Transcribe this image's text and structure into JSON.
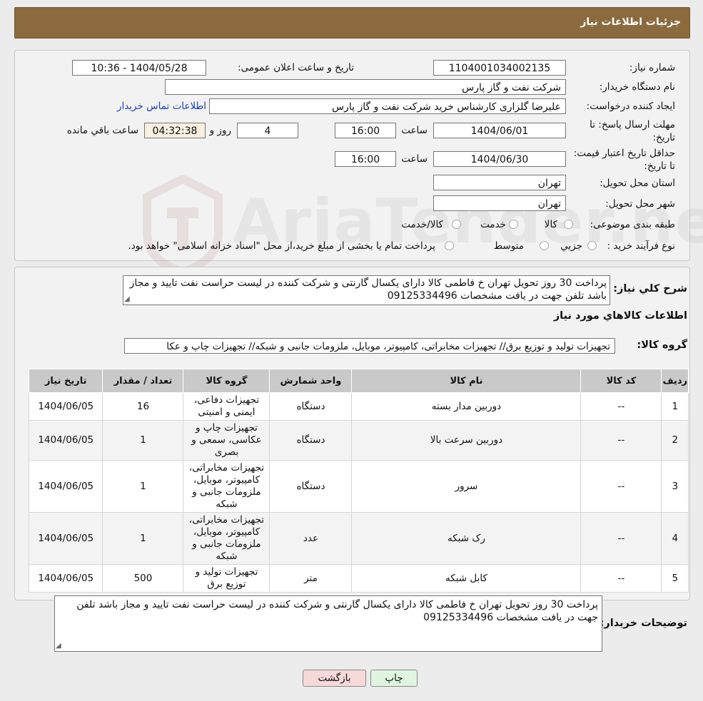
{
  "header": {
    "title": "جزئیات اطلاعات نیاز"
  },
  "form": {
    "need_number_label": "شماره نیاز:",
    "need_number": "1104001034002135",
    "announce_label": "تاریخ و ساعت اعلان عمومی:",
    "announce_value": "1404/05/28 - 10:36",
    "buyer_org_label": "نام دستگاه خریدار:",
    "buyer_org": "شرکت نفت و گاز پارس",
    "creator_label": "ایجاد کننده درخواست:",
    "creator": "علیرضا  گلزاری کارشناس خرید  شرکت نفت و گاز پارس",
    "contact_link": "اطلاعات تماس خریدار",
    "deadline_label": "مهلت ارسال پاسخ: تا تاریخ:",
    "deadline_date": "1404/06/01",
    "time_label": "ساعت",
    "deadline_time": "16:00",
    "days_value": "4",
    "days_label": "روز و",
    "remaining_time": "04:32:38",
    "remaining_label": "ساعت باقي مانده",
    "validity_label": "حداقل تاریخ اعتبار قیمت: تا تاریخ:",
    "validity_date": "1404/06/30",
    "validity_time": "16:00",
    "province_label": "استان محل تحویل:",
    "province": "تهران",
    "city_label": "شهر محل تحویل:",
    "city": "تهران",
    "category_label": "طبقه بندی موضوعی:",
    "category_options": [
      "کالا",
      "خدمت",
      "کالا/خدمت"
    ],
    "process_label": "نوع فرآیند خرید :",
    "process_options": [
      "جزیي",
      "متوسط"
    ],
    "process_note": "پرداخت تمام یا بخشی از مبلغ خرید،از محل \"اسناد خزانه اسلامی\" خواهد بود."
  },
  "summary": {
    "label": "شرح کلي نياز:",
    "text": "پرداخت 30 روز تحویل تهران خ فاطمی کالا دارای یکسال گارنتی  و شرکت کننده در لیست حراست نفت تایید و مجاز باشد تلفن جهت در یافت مشخصات 09125334496",
    "items_title": "اطلاعات کالاهاي مورد نياز",
    "group_label": "گروه کالا:",
    "group_value": "تجهیزات تولید و توزیع برق// تجهیزات مخابراتی، کامپیوتر، موبایل، ملزومات جانبی و شبکه// تجهیزات چاپ و عکا"
  },
  "table": {
    "headers": [
      "ردیف",
      "کد کالا",
      "نام کالا",
      "واحد شمارش",
      "گروه کالا",
      "تعداد / مقدار",
      "تاریخ نیاز"
    ],
    "rows": [
      {
        "row": "1",
        "code": "--",
        "name": "دوربین مدار بسته",
        "unit": "دستگاه",
        "group": "تجهیزات دفاعی، ایمنی و امنیتی",
        "qty": "16",
        "date": "1404/06/05"
      },
      {
        "row": "2",
        "code": "--",
        "name": "دوربین سرعت بالا",
        "unit": "دستگاه",
        "group": "تجهیزات چاپ و عکاسی، سمعی و بصری",
        "qty": "1",
        "date": "1404/06/05"
      },
      {
        "row": "3",
        "code": "--",
        "name": "سرور",
        "unit": "دستگاه",
        "group": "تجهیزات مخابراتی، کامپیوتر، موبایل، ملزومات جانبی و شبکه",
        "qty": "1",
        "date": "1404/06/05"
      },
      {
        "row": "4",
        "code": "--",
        "name": "رک شبکه",
        "unit": "عدد",
        "group": "تجهیزات مخابراتی، کامپیوتر، موبایل، ملزومات جانبی و شبکه",
        "qty": "1",
        "date": "1404/06/05"
      },
      {
        "row": "5",
        "code": "--",
        "name": "کابل شبکه",
        "unit": "متر",
        "group": "تجهیزات تولید و توزیع برق",
        "qty": "500",
        "date": "1404/06/05"
      }
    ]
  },
  "notes": {
    "label": "توضیحات خریدار:",
    "text": "پرداخت 30 روز تحویل تهران خ فاطمی کالا دارای یکسال گارنتی  و شرکت کننده در لیست حراست نفت تایید و مجاز باشد تلفن جهت در یافت مشخصات 09125334496"
  },
  "buttons": {
    "print": "چاپ",
    "back": "بازگشت"
  },
  "watermark": {
    "text": "AriaTender.neT"
  },
  "colors": {
    "header_bg": "#8b6b3e",
    "link": "#1a3fb6",
    "back_btn": "#f6d9d9",
    "print_btn": "#dff5df"
  }
}
